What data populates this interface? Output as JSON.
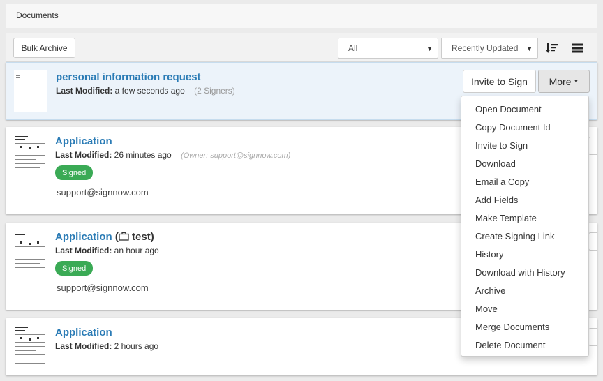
{
  "header": {
    "title": "Documents"
  },
  "toolbar": {
    "bulk_archive_label": "Bulk Archive",
    "filter_value": "All",
    "sort_value": "Recently Updated",
    "sort_icon": "sort-descending-icon",
    "view_icon": "list-view-icon"
  },
  "documents": [
    {
      "title": "personal information request",
      "modified_label": "Last Modified:",
      "modified_value": "a few seconds ago",
      "signers": "(2 Signers)",
      "invite_label": "Invite to Sign",
      "more_label": "More"
    },
    {
      "title": "Application",
      "modified_label": "Last Modified:",
      "modified_value": "26 minutes ago",
      "owner": "(Owner: support@signnow.com)",
      "status": "Signed",
      "email": "support@signnow.com"
    },
    {
      "title": "Application",
      "folder_open": "(",
      "folder_name": "test)",
      "folder_icon": "briefcase-icon",
      "modified_label": "Last Modified:",
      "modified_value": "an hour ago",
      "status": "Signed",
      "email": "support@signnow.com"
    },
    {
      "title": "Application",
      "modified_label": "Last Modified:",
      "modified_value": "2 hours ago"
    }
  ],
  "more_menu": {
    "items": [
      "Open Document",
      "Copy Document Id",
      "Invite to Sign",
      "Download",
      "Email a Copy",
      "Add Fields",
      "Make Template",
      "Create Signing Link",
      "History",
      "Download with History",
      "Archive",
      "Move",
      "Merge Documents",
      "Delete Document"
    ]
  },
  "colors": {
    "link": "#2a7bb5",
    "signed_badge": "#3aaa55",
    "selected_row": "#ecf3fa"
  }
}
